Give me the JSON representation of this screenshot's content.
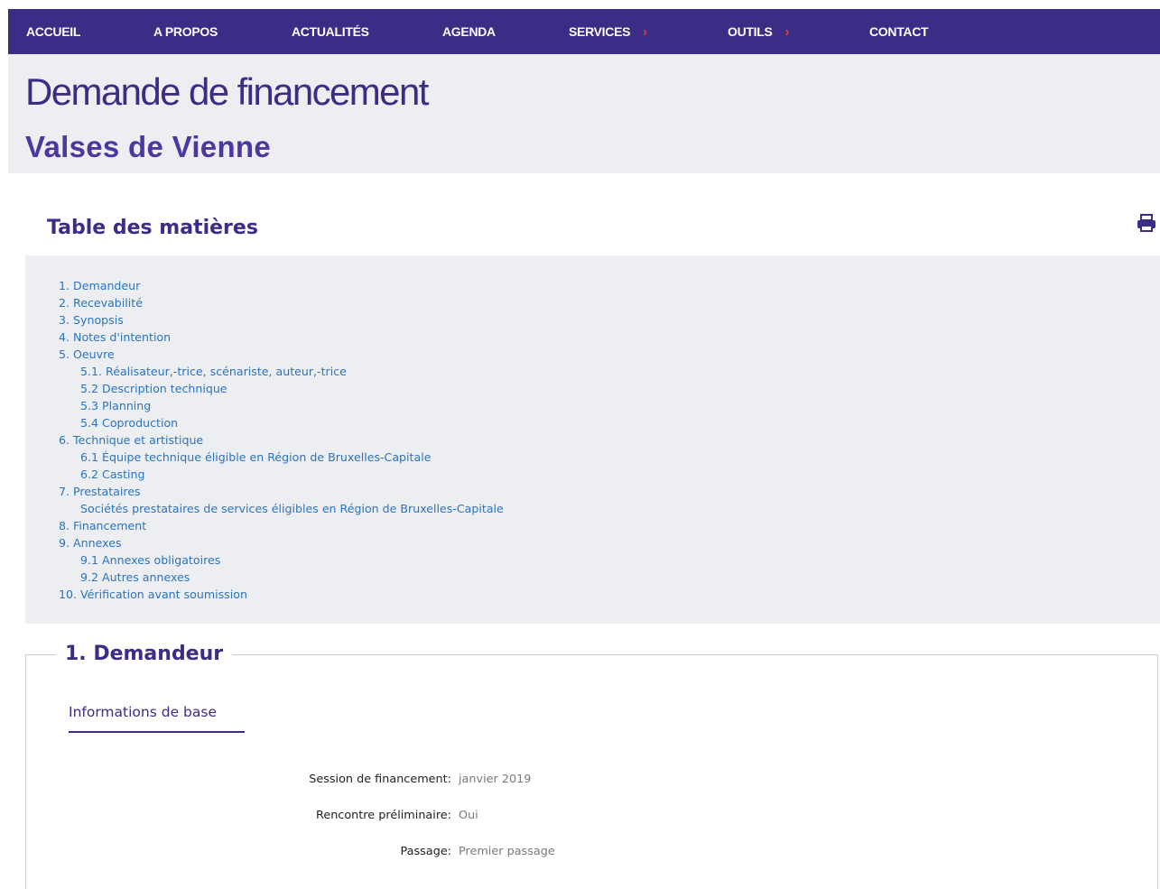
{
  "nav": {
    "items": [
      {
        "label": "ACCUEIL",
        "has_submenu": false
      },
      {
        "label": "A PROPOS",
        "has_submenu": false
      },
      {
        "label": "ACTUALITÉS",
        "has_submenu": false
      },
      {
        "label": "AGENDA",
        "has_submenu": false
      },
      {
        "label": "SERVICES",
        "has_submenu": true
      },
      {
        "label": "OUTILS",
        "has_submenu": true
      },
      {
        "label": "CONTACT",
        "has_submenu": false
      }
    ],
    "chevron": "›",
    "background": "#3a2d86",
    "chevron_color": "#e23b3b"
  },
  "header": {
    "title": "Demande de financement",
    "subtitle": "Valses de Vienne"
  },
  "toc": {
    "heading": "Table des matières",
    "print_icon": "printer-icon",
    "items": [
      {
        "label": "1. Demandeur",
        "level": 0
      },
      {
        "label": "2. Recevabilité",
        "level": 0
      },
      {
        "label": "3. Synopsis",
        "level": 0
      },
      {
        "label": "4. Notes d'intention",
        "level": 0
      },
      {
        "label": "5. Oeuvre",
        "level": 0
      },
      {
        "label": "5.1. Réalisateur,-trice, scénariste, auteur,-trice",
        "level": 1
      },
      {
        "label": "5.2 Description technique",
        "level": 1
      },
      {
        "label": "5.3 Planning",
        "level": 1
      },
      {
        "label": "5.4 Coproduction",
        "level": 1
      },
      {
        "label": "6. Technique et artistique",
        "level": 0
      },
      {
        "label": "6.1 Équipe technique éligible en Région de Bruxelles-Capitale",
        "level": 1
      },
      {
        "label": "6.2 Casting",
        "level": 1
      },
      {
        "label": "7. Prestataires",
        "level": 0
      },
      {
        "label": "Sociétés prestataires de services éligibles en Région de Bruxelles-Capitale",
        "level": 1
      },
      {
        "label": "8. Financement",
        "level": 0
      },
      {
        "label": "9. Annexes",
        "level": 0
      },
      {
        "label": "9.1 Annexes obligatoires",
        "level": 1
      },
      {
        "label": "9.2 Autres annexes",
        "level": 1
      },
      {
        "label": "10. Vérification avant soumission",
        "level": 0
      }
    ],
    "link_color": "#2a74bf"
  },
  "section": {
    "title": "1. Demandeur",
    "subsection_tab": "Informations de base",
    "fields": [
      {
        "label": "Session de financement:",
        "value": "janvier 2019"
      },
      {
        "label": "Rencontre préliminaire:",
        "value": "Oui"
      },
      {
        "label": "Passage:",
        "value": "Premier passage"
      }
    ]
  }
}
